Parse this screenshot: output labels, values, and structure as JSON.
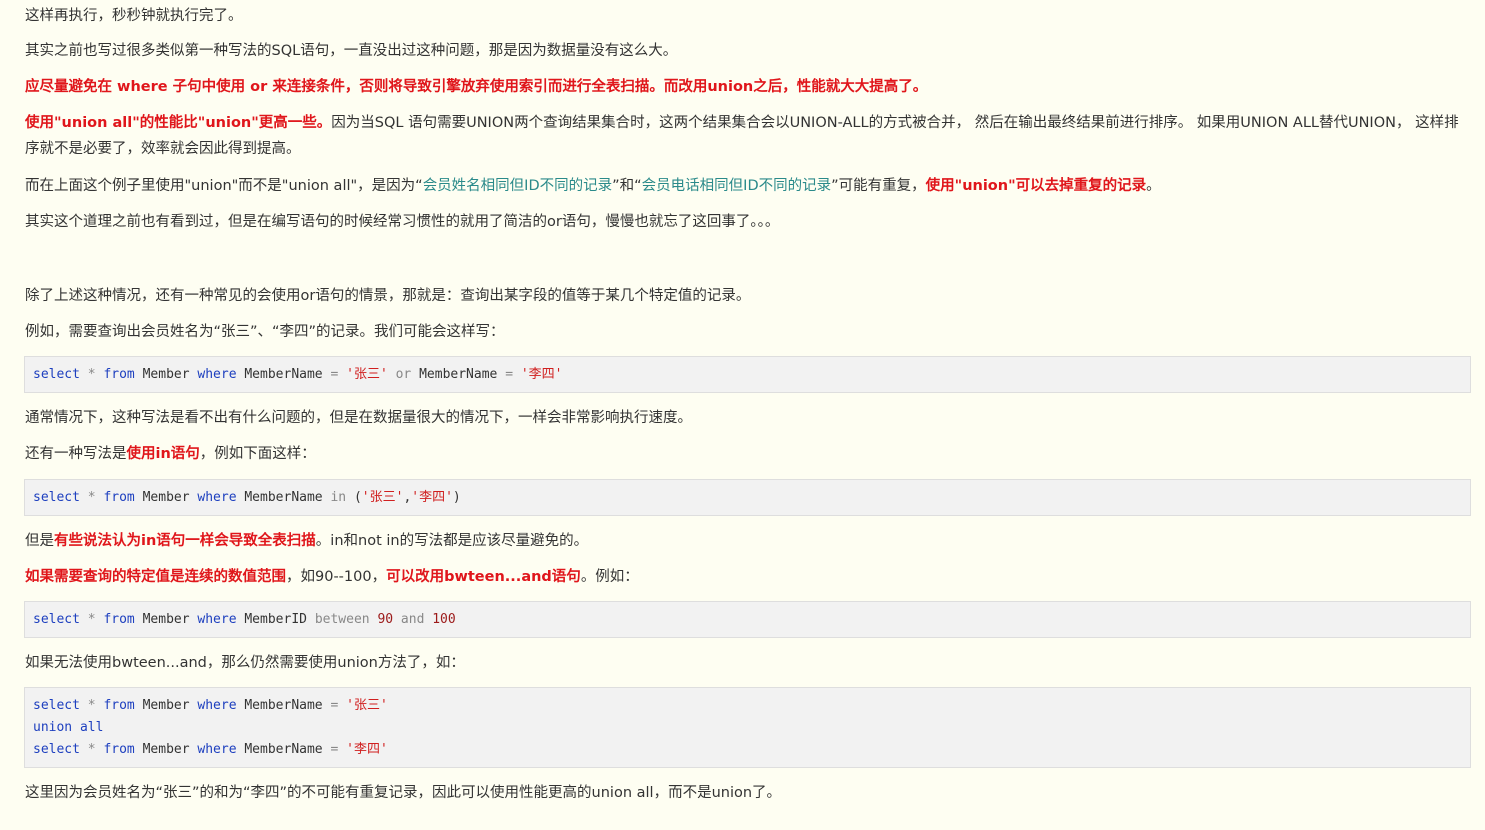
{
  "paragraphs": {
    "p1": "这样再执行，秒秒钟就执行完了。",
    "p2": "其实之前也写过很多类似第一种写法的SQL语句，一直没出过这种问题，那是因为数据量没有这么大。",
    "p3": "应尽量避免在 where 子句中使用 or 来连接条件，否则将导致引擎放弃使用索引而进行全表扫描。而改用union之后，性能就大大提高了。",
    "p4_bold": "使用\"union all\"的性能比\"union\"更高一些。",
    "p4_rest": "因为当SQL 语句需要UNION两个查询结果集合时，这两个结果集合会以UNION-ALL的方式被合并， 然后在输出最终结果前进行排序。 如果用UNION ALL替代UNION， 这样排序就不是必要了，效率就会因此得到提高。",
    "p5_a": "而在上面这个例子里使用\"union\"而不是\"union all\"，是因为“",
    "p5_teal1": "会员姓名相同但ID不同的记录",
    "p5_b": "”和“",
    "p5_teal2": "会员电话相同但ID不同的记录",
    "p5_c": "”可能有重复，",
    "p5_bold": "使用\"union\"可以去掉重复的记录",
    "p5_end": "。",
    "p6": "其实这个道理之前也有看到过，但是在编写语句的时候经常习惯性的就用了简洁的or语句，慢慢也就忘了这回事了。。。",
    "p7": "除了上述这种情况，还有一种常见的会使用or语句的情景，那就是：查询出某字段的值等于某几个特定值的记录。",
    "p8": "例如，需要查询出会员姓名为“张三”、“李四”的记录。我们可能会这样写：",
    "p9": "通常情况下，这种写法是看不出有什么问题的，但是在数据量很大的情况下，一样会非常影响执行速度。",
    "p10_a": "还有一种写法是",
    "p10_bold": "使用in语句",
    "p10_b": "，例如下面这样：",
    "p11_a": "但是",
    "p11_bold": "有些说法认为in语句一样会导致全表扫描",
    "p11_b": "。in和not in的写法都是应该尽量避免的。",
    "p12_bold1": "如果需要查询的特定值是连续的数值范围",
    "p12_a": "，如90--100，",
    "p12_bold2": "可以改用bwteen...and语句",
    "p12_b": "。例如：",
    "p13": "如果无法使用bwteen...and，那么仍然需要使用union方法了，如：",
    "p14": "这里因为会员姓名为“张三”的和为“李四”的不可能有重复记录，因此可以使用性能更高的union all，而不是union了。"
  },
  "code": {
    "select": "select",
    "star": "*",
    "from": "from",
    "table": "Member",
    "where": "where",
    "col_name": "MemberName",
    "col_id": "MemberID",
    "eq": "=",
    "or": "or",
    "in": "in",
    "between": "between",
    "and": "and",
    "v_zhang": "'张三'",
    "v_li": "'李四'",
    "n90": "90",
    "n100": "100",
    "union_all": "union all",
    "lparen": "(",
    "comma": ",",
    "rparen": ")"
  }
}
